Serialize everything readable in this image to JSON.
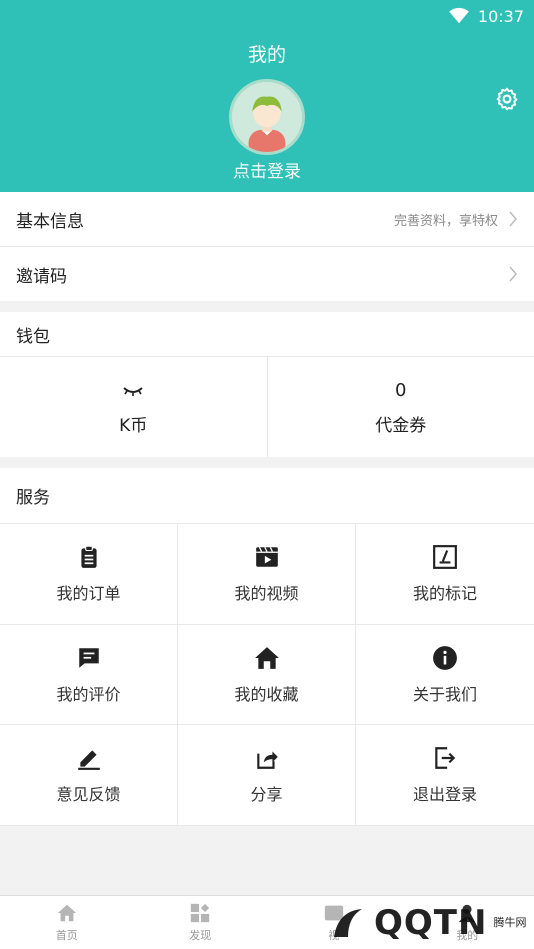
{
  "status_bar": {
    "time": "10:37"
  },
  "header": {
    "title": "我的",
    "login_text": "点击登录"
  },
  "rows": {
    "basic_info": {
      "label": "基本信息",
      "hint": "完善资料，享特权"
    },
    "invite_code": {
      "label": "邀请码"
    }
  },
  "wallet": {
    "title": "钱包",
    "kcoin": {
      "label": "K币"
    },
    "voucher": {
      "value": "0",
      "label": "代金券"
    }
  },
  "services": {
    "title": "服务",
    "items": [
      {
        "label": "我的订单",
        "icon": "clipboard-icon"
      },
      {
        "label": "我的视频",
        "icon": "video-icon"
      },
      {
        "label": "我的标记",
        "icon": "mark-icon"
      },
      {
        "label": "我的评价",
        "icon": "comment-icon"
      },
      {
        "label": "我的收藏",
        "icon": "home-icon"
      },
      {
        "label": "关于我们",
        "icon": "info-icon"
      },
      {
        "label": "意见反馈",
        "icon": "pencil-icon"
      },
      {
        "label": "分享",
        "icon": "share-icon"
      },
      {
        "label": "退出登录",
        "icon": "logout-icon"
      }
    ]
  },
  "tabbar": {
    "tabs": [
      {
        "label": "首页"
      },
      {
        "label": "发现"
      },
      {
        "label": "视"
      },
      {
        "label": "我的"
      }
    ]
  },
  "watermark": {
    "brand": "QQTN",
    "site": "腾牛网"
  },
  "colors": {
    "accent": "#2fc0b8"
  }
}
